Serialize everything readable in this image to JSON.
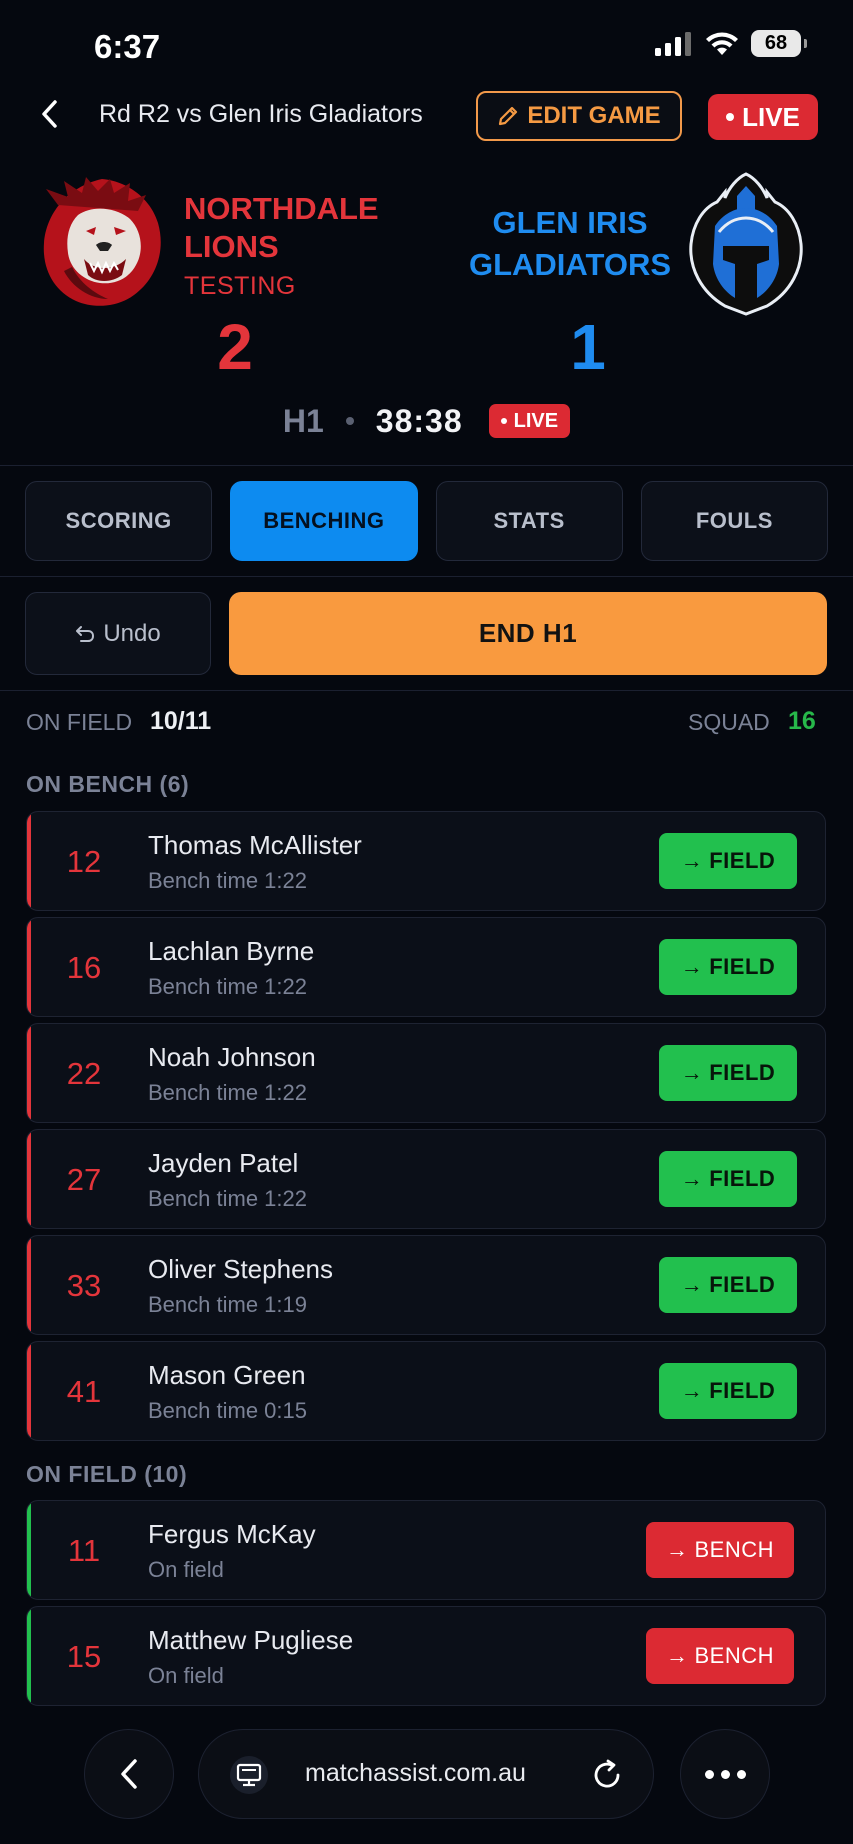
{
  "status_bar": {
    "time": "6:37",
    "battery": "68"
  },
  "header": {
    "title": "Rd R2 vs Glen Iris Gladiators",
    "edit_label": "EDIT GAME",
    "live_label": "LIVE"
  },
  "scoreboard": {
    "home": {
      "name": "NORTHDALE LIONS",
      "subtitle": "TESTING",
      "score": "2",
      "color": "#e4353b"
    },
    "away": {
      "name": "GLEN IRIS GLADIATORS",
      "score": "1",
      "color": "#1f8cf0"
    },
    "period": "H1",
    "clock": "38:38",
    "live_label": "LIVE"
  },
  "tabs": [
    {
      "label": "SCORING",
      "active": false
    },
    {
      "label": "BENCHING",
      "active": true
    },
    {
      "label": "STATS",
      "active": false
    },
    {
      "label": "FOULS",
      "active": false
    }
  ],
  "actions": {
    "undo_label": "Undo",
    "end_label": "END H1"
  },
  "counts": {
    "on_field_label": "ON FIELD",
    "on_field_value": "10/11",
    "squad_label": "SQUAD",
    "squad_value": "16"
  },
  "bench": {
    "title": "ON BENCH (6)",
    "button_label": "FIELD",
    "players": [
      {
        "number": "12",
        "name": "Thomas McAllister",
        "status": "Bench time 1:22"
      },
      {
        "number": "16",
        "name": "Lachlan Byrne",
        "status": "Bench time 1:22"
      },
      {
        "number": "22",
        "name": "Noah Johnson",
        "status": "Bench time 1:22"
      },
      {
        "number": "27",
        "name": "Jayden Patel",
        "status": "Bench time 1:22"
      },
      {
        "number": "33",
        "name": "Oliver Stephens",
        "status": "Bench time 1:19"
      },
      {
        "number": "41",
        "name": "Mason Green",
        "status": "Bench time 0:15"
      }
    ]
  },
  "field": {
    "title": "ON FIELD (10)",
    "button_label": "BENCH",
    "players": [
      {
        "number": "11",
        "name": "Fergus McKay",
        "status": "On field"
      },
      {
        "number": "15",
        "name": "Matthew Pugliese",
        "status": "On field"
      }
    ]
  },
  "browser": {
    "url": "matchassist.com.au"
  },
  "colors": {
    "accent_blue": "#0d8bf0",
    "accent_orange": "#f99a3f",
    "green": "#22c04e",
    "red": "#dc2a33"
  }
}
